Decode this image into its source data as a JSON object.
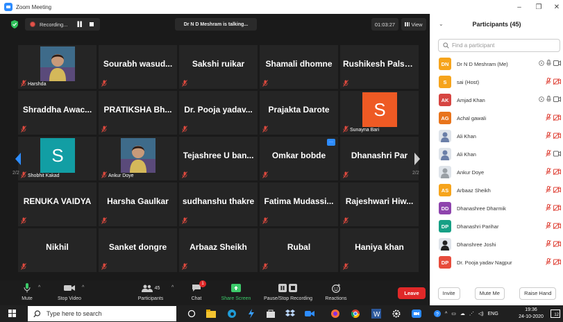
{
  "window": {
    "title": "Zoom Meeting",
    "minimize": "–",
    "maximize": "❐",
    "close": "✕"
  },
  "topbar": {
    "recording_label": "Recording...",
    "talking_label": "Dr N D Meshram is talking...",
    "timer": "01:03:27",
    "view_label": "View"
  },
  "grid": {
    "tiles": [
      {
        "label": "Harshda",
        "kind": "photo"
      },
      {
        "name": "Sourabh wasud..."
      },
      {
        "name": "Sakshi ruikar"
      },
      {
        "name": "Shamali dhomne"
      },
      {
        "name": "Rushikesh Palso..."
      },
      {
        "name": "Shraddha Awac..."
      },
      {
        "name": "PRATIKSHA Bh..."
      },
      {
        "name": "Dr. Pooja yadav..."
      },
      {
        "name": "Prajakta Darote"
      },
      {
        "label": "Sunayna Bari",
        "kind": "avatar",
        "letter": "S",
        "color": "#ee5a24"
      },
      {
        "label": "Shobhit Kakad",
        "kind": "avatar",
        "letter": "S",
        "color": "#129ea4"
      },
      {
        "label": "Ankur Doye",
        "kind": "photo"
      },
      {
        "name": "Tejashree U ban..."
      },
      {
        "name": "Omkar bobde"
      },
      {
        "name": "Dhanashri Par"
      },
      {
        "name": "RENUKA VAIDYA"
      },
      {
        "name": "Harsha Gaulkar"
      },
      {
        "name": "sudhanshu thakre"
      },
      {
        "name": "Fatima Mudassi..."
      },
      {
        "name": "Rajeshwari Hiw..."
      },
      {
        "name": "Nikhil"
      },
      {
        "name": "Sanket dongre"
      },
      {
        "name": "Arbaaz Sheikh"
      },
      {
        "name": "Rubal"
      },
      {
        "name": "Haniya khan"
      }
    ],
    "page_left": "2/2",
    "page_right": "2/2"
  },
  "toolbar": {
    "mute": "Mute",
    "stop_video": "Stop Video",
    "participants": "Participants",
    "participants_count": "45",
    "chat": "Chat",
    "chat_badge": "1",
    "share_screen": "Share Screen",
    "recording": "Pause/Stop Recording",
    "reactions": "Reactions",
    "leave": "Leave"
  },
  "panel": {
    "title": "Participants (45)",
    "search_placeholder": "Find a participant",
    "participants": [
      {
        "initials": "DN",
        "name": "Dr N D Meshram (Me)",
        "color": "#f6a41c",
        "status": "host"
      },
      {
        "initials": "S",
        "name": "sai (Host)",
        "color": "#f6a41c",
        "status": "muted"
      },
      {
        "initials": "AK",
        "name": "Amjad Khan",
        "color": "#d64541",
        "status": "host"
      },
      {
        "initials": "AG",
        "name": "Achal gawali",
        "color": "#e8741c",
        "status": "muted"
      },
      {
        "initials": "",
        "name": "Ali Khan",
        "color": "#6b7fa8",
        "status": "muted"
      },
      {
        "initials": "",
        "name": "Ali Khan",
        "color": "#6b7fa8",
        "status": "muted-video"
      },
      {
        "initials": "",
        "name": "Ankur Doye",
        "color": "#9aa0a6",
        "status": "muted"
      },
      {
        "initials": "AS",
        "name": "Arbaaz Sheikh",
        "color": "#f6a41c",
        "status": "muted"
      },
      {
        "initials": "DD",
        "name": "Dhanashree Dharmik",
        "color": "#8e44ad",
        "status": "muted"
      },
      {
        "initials": "DP",
        "name": "Dhanashri Parihar",
        "color": "#16a085",
        "status": "muted"
      },
      {
        "initials": "",
        "name": "Dhanshree Joshi",
        "color": "#222222",
        "status": "muted"
      },
      {
        "initials": "DP",
        "name": "Dr. Pooja yadav Nagpur",
        "color": "#e74c3c",
        "status": "muted"
      }
    ],
    "invite": "Invite",
    "mute_me": "Mute Me",
    "raise_hand": "Raise Hand"
  },
  "taskbar": {
    "search_placeholder": "Type here to search",
    "lang": "ENG",
    "time": "19:36",
    "date": "24-10-2020",
    "notif": "12"
  },
  "colors": {
    "accent": "#2d8cff",
    "leave": "#e02828",
    "muted": "#e04a3f",
    "share": "#3ccb6a"
  }
}
